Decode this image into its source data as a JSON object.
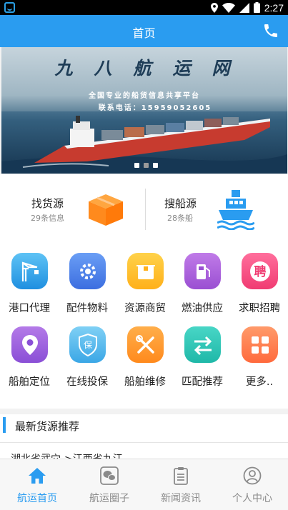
{
  "status_bar": {
    "time": "2:27"
  },
  "header": {
    "title": "首页",
    "phone_icon": "phone-icon"
  },
  "banner": {
    "title": "九八航运网",
    "subtitle": "全国专业的船货信息共享平台",
    "contact": "联系电话：15959052605",
    "pages": 3,
    "active_page": 2
  },
  "sources": {
    "goods": {
      "title": "找货源",
      "count": "29条信息",
      "icon": "cargo-box-icon",
      "color": "#ff8a1d"
    },
    "ships": {
      "title": "搜船源",
      "count": "28条船",
      "icon": "ship-icon",
      "color": "#2a9cf0"
    }
  },
  "services": [
    {
      "label": "港口代理",
      "icon": "crane-icon"
    },
    {
      "label": "配件物料",
      "icon": "gear-icon"
    },
    {
      "label": "资源商贸",
      "icon": "package-icon"
    },
    {
      "label": "燃油供应",
      "icon": "fuel-pump-icon"
    },
    {
      "label": "求职招聘",
      "icon": "recruit-icon"
    },
    {
      "label": "船舶定位",
      "icon": "location-pin-icon"
    },
    {
      "label": "在线投保",
      "icon": "insurance-shield-icon"
    },
    {
      "label": "船舶维修",
      "icon": "tools-icon"
    },
    {
      "label": "匹配推荐",
      "icon": "swap-arrows-icon"
    },
    {
      "label": "更多..",
      "icon": "more-apps-icon"
    }
  ],
  "latest": {
    "title": "最新货源推荐",
    "first_route": "湖北省武穴->江西省九江"
  },
  "bottom_nav": [
    {
      "label": "航运首页",
      "icon": "home-icon",
      "active": true
    },
    {
      "label": "航运圈子",
      "icon": "chat-icon",
      "active": false
    },
    {
      "label": "新闻资讯",
      "icon": "news-icon",
      "active": false
    },
    {
      "label": "个人中心",
      "icon": "user-icon",
      "active": false
    }
  ],
  "colors": {
    "primary": "#2a9cf0",
    "accent": "#ff8a1d"
  }
}
